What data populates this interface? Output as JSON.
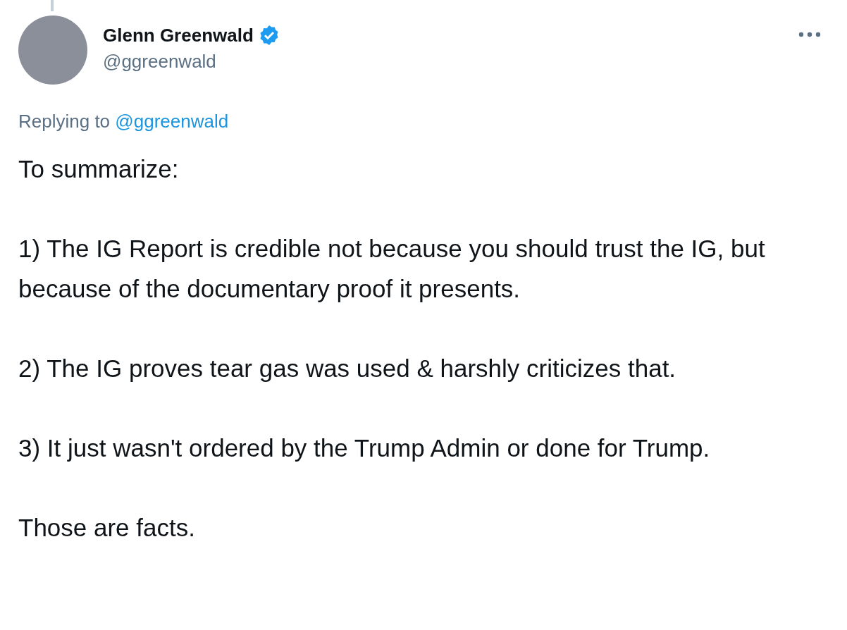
{
  "tweet": {
    "author": {
      "name": "Glenn Greenwald",
      "verified": true,
      "handle": "@ggreenwald"
    },
    "reply_prefix": "Replying to",
    "reply_to": "@ggreenwald",
    "paragraphs": [
      "To summarize:",
      "1) The IG Report is credible not because you should trust the IG, but because of the documentary proof it presents.",
      "2) The IG proves tear gas was used & harshly criticizes that.",
      "3) It just wasn't ordered by the Trump Admin or done for Trump.",
      "Those are facts."
    ]
  }
}
